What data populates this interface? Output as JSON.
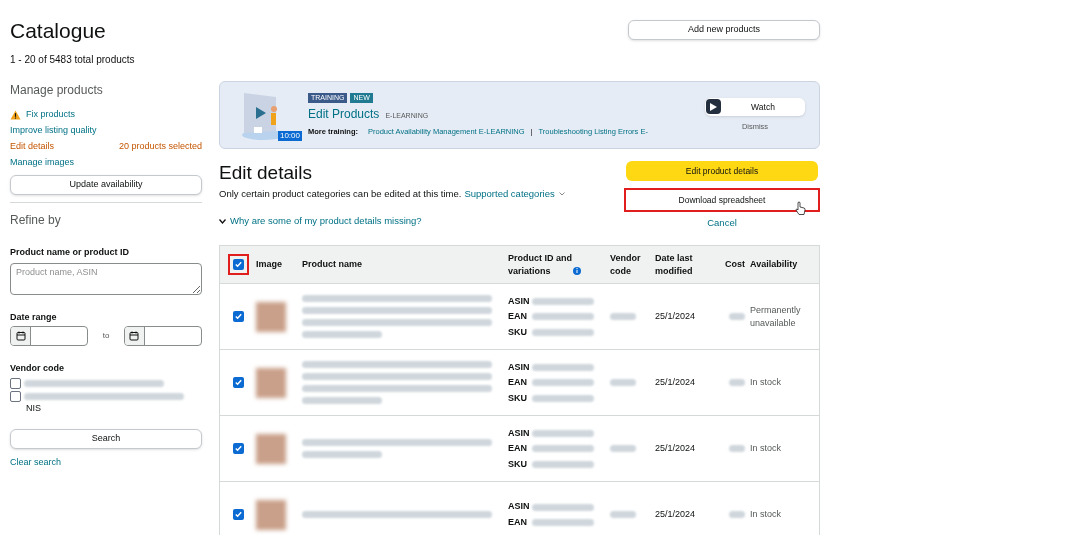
{
  "header": {
    "title": "Catalogue",
    "count": "1 - 20 of 5483 total products",
    "add_button": "Add new products"
  },
  "sidebar": {
    "manage_title": "Manage products",
    "links": [
      {
        "kind": "warning",
        "label": "Fix products"
      },
      {
        "kind": "link",
        "label": "Improve listing quality"
      },
      {
        "kind": "active",
        "label": "Edit details",
        "note": "20 products selected"
      },
      {
        "kind": "link",
        "label": "Manage images"
      }
    ],
    "update_button": "Update availability",
    "refine_title": "Refine by",
    "product_field": {
      "label": "Product name or product ID",
      "placeholder": "Product name, ASIN"
    },
    "date_range": {
      "label": "Date range",
      "separator": "to"
    },
    "vendor": {
      "label": "Vendor code",
      "options": [
        {
          "checked": false
        },
        {
          "checked": false,
          "suffix": "NIS"
        }
      ]
    },
    "search_button": "Search",
    "clear_link": "Clear search"
  },
  "training": {
    "badges": [
      "TRAINING",
      "NEW"
    ],
    "title": "Edit Products",
    "type": "E-LEARNING",
    "duration": "10:00",
    "more_label": "More training:",
    "more_links": [
      "Product Availability Management E-LEARNING",
      "Troubleshooting Listing Errors E-"
    ],
    "separator": "|",
    "watch_button": "Watch",
    "dismiss": "Dismiss"
  },
  "edit": {
    "title": "Edit details",
    "note": "Only certain product categories can be edited at this time.",
    "categories_link": "Supported categories",
    "missing_link": "Why are some of my product details missing?",
    "primary_button": "Edit product details",
    "download_button": {
      "label": "Download spreadsheet",
      "highlighted": true
    },
    "cancel": "Cancel"
  },
  "table": {
    "select_all": {
      "checked": true,
      "highlighted": true
    },
    "columns": [
      "Image",
      "Product name",
      "Product ID and variations",
      "Vendor code",
      "Date last modified",
      "Cost",
      "Availability"
    ],
    "rows": [
      {
        "checked": true,
        "id_labels": [
          "ASIN",
          "EAN",
          "SKU"
        ],
        "date": "25/1/2024",
        "availability": "Permanently unavailable"
      },
      {
        "checked": true,
        "id_labels": [
          "ASIN",
          "EAN",
          "SKU"
        ],
        "date": "25/1/2024",
        "availability": "In stock"
      },
      {
        "checked": true,
        "id_labels": [
          "ASIN",
          "EAN",
          "SKU"
        ],
        "date": "25/1/2024",
        "availability": "In stock"
      },
      {
        "checked": true,
        "id_labels": [
          "ASIN",
          "EAN"
        ],
        "date": "25/1/2024",
        "availability": "In stock"
      }
    ]
  }
}
